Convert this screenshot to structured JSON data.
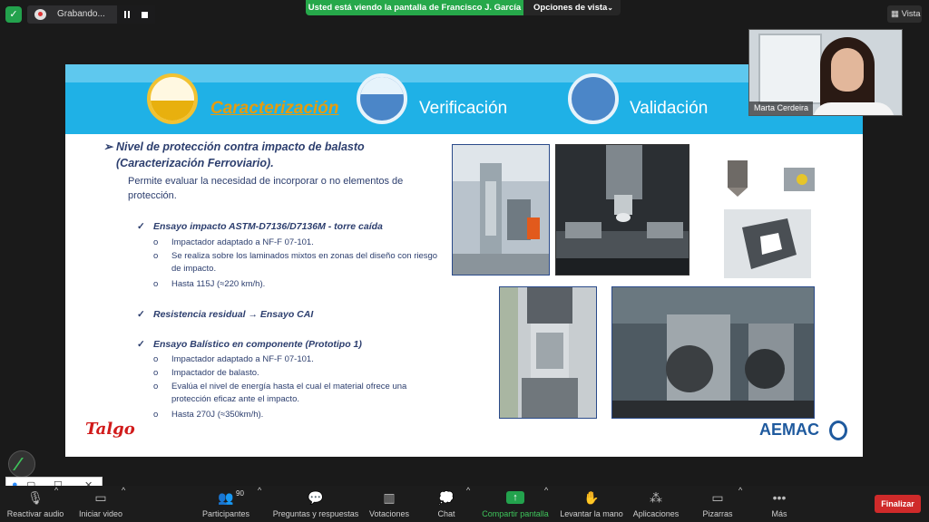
{
  "recording": {
    "label": "Grabando..."
  },
  "banner": {
    "viewing_text": "Usted está viendo la pantalla de Francisco J. García",
    "view_options": "Opciones de vista",
    "view_button": "Vista"
  },
  "slide": {
    "tabs": [
      {
        "label": "Caracterización",
        "active": true
      },
      {
        "label": "Verificación",
        "active": false
      },
      {
        "label": "Validación",
        "active": false
      }
    ],
    "heading": "Nivel de protección contra impacto de balasto (Caracterización Ferroviario).",
    "intro": "Permite evaluar la necesidad de incorporar o no  elementos de protección.",
    "sections": [
      {
        "title": "Ensayo impacto ASTM-D7136/D7136M - torre caída",
        "items": [
          "Impactador adaptado a NF-F 07-101.",
          "Se realiza sobre los laminados mixtos en zonas del diseño con riesgo de impacto.",
          "Hasta 115J (≈220 km/h)."
        ]
      },
      {
        "title": "Resistencia residual → Ensayo CAI",
        "items": []
      },
      {
        "title": "Ensayo Balístico en componente (Prototipo 1)",
        "items": [
          "Impactador adaptado a NF-F 07-101.",
          "Impactador de balasto.",
          "Evalúa el nivel de energía hasta el cual el material ofrece una protección eficaz ante el impacto.",
          "Hasta 270J (≈350km/h)."
        ]
      }
    ],
    "logo_left": "Talgo",
    "logo_right": "AEMAC"
  },
  "webcam": {
    "name": "Marta Cerdeira"
  },
  "toolbar": {
    "items": [
      {
        "label": "Reactivar audio",
        "icon": "muted-mic-icon"
      },
      {
        "label": "Iniciar video",
        "icon": "video-off-icon"
      },
      {
        "label": "Participantes",
        "icon": "participants-icon",
        "count": "90"
      },
      {
        "label": "Preguntas y respuestas",
        "icon": "qa-icon"
      },
      {
        "label": "Votaciones",
        "icon": "polls-icon"
      },
      {
        "label": "Chat",
        "icon": "chat-icon"
      },
      {
        "label": "Compartir pantalla",
        "icon": "share-screen-icon"
      },
      {
        "label": "Levantar la mano",
        "icon": "raise-hand-icon"
      },
      {
        "label": "Aplicaciones",
        "icon": "apps-icon"
      },
      {
        "label": "Pizarras",
        "icon": "whiteboard-icon"
      },
      {
        "label": "Más",
        "icon": "more-icon"
      }
    ],
    "end_label": "Finalizar"
  },
  "colors": {
    "accent_green": "#23a24d",
    "slide_blue": "#1fb1e6",
    "active_tab": "#e69c0d",
    "end_red": "#cf2a2a"
  }
}
